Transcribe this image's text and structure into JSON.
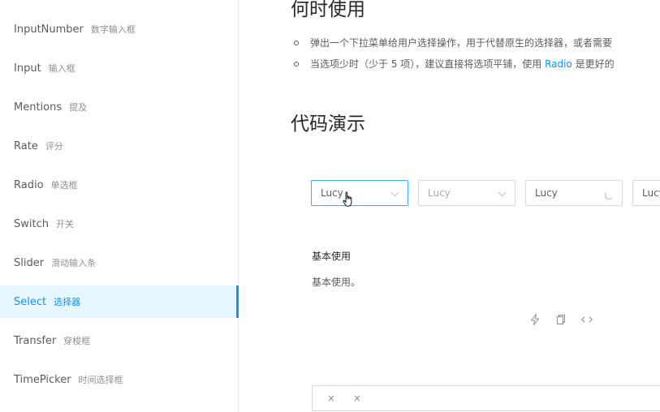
{
  "sidebar": {
    "items": [
      {
        "label": "InputNumber",
        "cn": "数字输入框"
      },
      {
        "label": "Input",
        "cn": "输入框"
      },
      {
        "label": "Mentions",
        "cn": "提及"
      },
      {
        "label": "Rate",
        "cn": "评分"
      },
      {
        "label": "Radio",
        "cn": "单选框"
      },
      {
        "label": "Switch",
        "cn": "开关"
      },
      {
        "label": "Slider",
        "cn": "滑动输入条"
      },
      {
        "label": "Select",
        "cn": "选择器",
        "selected": true
      },
      {
        "label": "Transfer",
        "cn": "穿梭框"
      },
      {
        "label": "TimePicker",
        "cn": "时间选择框"
      }
    ]
  },
  "main": {
    "when_heading": "何时使用",
    "bullet1": "弹出一个下拉菜单给用户选择操作，用于代替原生的选择器，或者需要",
    "bullet2_pre": "当选项少时（少于 5 项），建议直接将选项平铺，使用 ",
    "bullet2_link": "Radio",
    "bullet2_post": " 是更好的",
    "demo_heading": "代码演示",
    "selects": [
      {
        "value": "Lucy",
        "state": "focused",
        "suffix": "chevron-down-icon"
      },
      {
        "value": "Lucy",
        "state": "disabled",
        "suffix": "chevron-down-icon"
      },
      {
        "value": "Lucy",
        "state": "loading",
        "suffix": "loading-icon"
      },
      {
        "value": "Lucy",
        "state": "default",
        "suffix": ""
      }
    ],
    "demo_title": "基本使用",
    "demo_desc": "基本使用。",
    "actions": [
      "thunderbolt-icon",
      "copy-icon",
      "code-icon"
    ],
    "multi_tags": [
      "×",
      "×"
    ]
  },
  "colors": {
    "primary": "#1890ff",
    "selected_bg": "#e6f7ff",
    "border": "#d9d9d9",
    "focus_border": "#40a9ff"
  }
}
